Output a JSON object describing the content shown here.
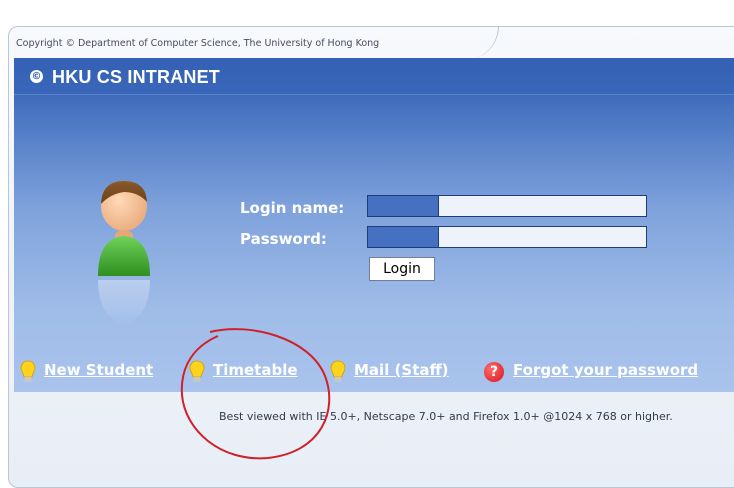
{
  "copyright": "Copyright © Department of Computer Science, The University of Hong Kong",
  "header": {
    "title": "HKU CS INTRANET",
    "logo_glyph": "©"
  },
  "form": {
    "login_label": "Login name:",
    "password_label": "Password:",
    "login_value": "",
    "password_value": "",
    "login_button": "Login"
  },
  "links": [
    {
      "label": "New Student",
      "icon": "lightbulb-icon"
    },
    {
      "label": "Timetable",
      "icon": "lightbulb-icon"
    },
    {
      "label": "Mail (Staff)",
      "icon": "lightbulb-icon"
    },
    {
      "label": "Forgot your password",
      "icon": "help-icon",
      "icon_glyph": "?"
    }
  ],
  "footer_note": "Best viewed with IE 5.0+, Netscape 7.0+ and Firefox 1.0+ @1024 x 768 or higher.",
  "colors": {
    "panel_top": "#2c57ac",
    "panel_bottom": "#a9c3ec",
    "link_text": "#ffffff",
    "annotation": "#d0202a"
  }
}
